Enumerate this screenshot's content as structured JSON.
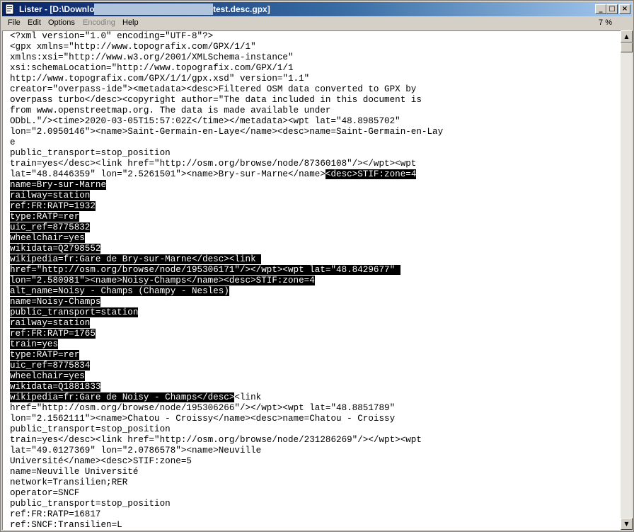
{
  "window": {
    "title_prefix": "Lister - [D:\\Downlo",
    "title_suffix": "test.desc.gpx]",
    "minimize_glyph": "_",
    "maximize_glyph": "□",
    "close_glyph": "×"
  },
  "menu": {
    "items": [
      "File",
      "Edit",
      "Options",
      "Encoding",
      "Help"
    ],
    "percent": "7 %"
  },
  "colors": {
    "titlebar_start": "#0a246a",
    "titlebar_end": "#a6caf0",
    "selection_bg": "#000000",
    "selection_fg": "#ffffff"
  },
  "icons": {
    "app": "lister-document-icon",
    "scroll_up": "scroll-up-arrow-icon",
    "scroll_down": "scroll-down-arrow-icon"
  },
  "lines": [
    [
      {
        "t": "<?xml version=\"1.0\" encoding=\"UTF-8\"?>",
        "s": false
      }
    ],
    [
      {
        "t": "<gpx xmlns=\"http://www.topografix.com/GPX/1/1\"",
        "s": false
      }
    ],
    [
      {
        "t": "xmlns:xsi=\"http://www.w3.org/2001/XMLSchema-instance\"",
        "s": false
      }
    ],
    [
      {
        "t": "xsi:schemaLocation=\"http://www.topografix.com/GPX/1/1",
        "s": false
      }
    ],
    [
      {
        "t": "http://www.topografix.com/GPX/1/1/gpx.xsd\" version=\"1.1\"",
        "s": false
      }
    ],
    [
      {
        "t": "creator=\"overpass-ide\"><metadata><desc>Filtered OSM data converted to GPX by",
        "s": false
      }
    ],
    [
      {
        "t": "overpass turbo</desc><copyright author=\"The data included in this document is",
        "s": false
      }
    ],
    [
      {
        "t": "from www.openstreetmap.org. The data is made available under",
        "s": false
      }
    ],
    [
      {
        "t": "ODbL.\"/><time>2020-03-05T15:57:02Z</time></metadata><wpt lat=\"48.8985702\"",
        "s": false
      }
    ],
    [
      {
        "t": "lon=\"2.0950146\"><name>Saint-Germain-en-Laye</name><desc>name=Saint-Germain-en-Lay",
        "s": false
      }
    ],
    [
      {
        "t": "e",
        "s": false
      }
    ],
    [
      {
        "t": "public_transport=stop_position",
        "s": false
      }
    ],
    [
      {
        "t": "train=yes</desc><link href=\"http://osm.org/browse/node/87360108\"/></wpt><wpt",
        "s": false
      }
    ],
    [
      {
        "t": "lat=\"48.8446359\" lon=\"2.5261501\"><name>Bry-sur-Marne</name>",
        "s": false
      },
      {
        "t": "<desc>STIF:zone=4",
        "s": true
      }
    ],
    [
      {
        "t": "name=Bry-sur-Marne",
        "s": true
      }
    ],
    [
      {
        "t": "railway=station",
        "s": true
      }
    ],
    [
      {
        "t": "ref:FR:RATP=1932",
        "s": true
      }
    ],
    [
      {
        "t": "type:RATP=rer",
        "s": true
      }
    ],
    [
      {
        "t": "uic_ref=8775832",
        "s": true
      }
    ],
    [
      {
        "t": "wheelchair=yes",
        "s": true
      }
    ],
    [
      {
        "t": "wikidata=Q2798552",
        "s": true
      }
    ],
    [
      {
        "t": "wikipedia=fr:Gare de Bry-sur-Marne</desc><link ",
        "s": true
      }
    ],
    [
      {
        "t": "href=\"http://osm.org/browse/node/195306171\"/></wpt><wpt lat=\"48.8429677\" ",
        "s": true
      }
    ],
    [
      {
        "t": "lon=\"2.580981\"><name>Noisy-Champs</name><desc>STIF:zone=4",
        "s": true
      }
    ],
    [
      {
        "t": "alt_name=Noisy - Champs (Champy - Nesles)",
        "s": true
      }
    ],
    [
      {
        "t": "name=Noisy-Champs",
        "s": true
      }
    ],
    [
      {
        "t": "public_transport=station",
        "s": true
      }
    ],
    [
      {
        "t": "railway=station",
        "s": true
      }
    ],
    [
      {
        "t": "ref:FR:RATP=1765",
        "s": true
      }
    ],
    [
      {
        "t": "train=yes",
        "s": true
      }
    ],
    [
      {
        "t": "type:RATP=rer",
        "s": true
      }
    ],
    [
      {
        "t": "uic_ref=8775834",
        "s": true
      }
    ],
    [
      {
        "t": "wheelchair=yes",
        "s": true
      }
    ],
    [
      {
        "t": "wikidata=Q1881833",
        "s": true
      }
    ],
    [
      {
        "t": "wikipedia=fr:Gare de Noisy - Champs</desc>",
        "s": true
      },
      {
        "t": "<link",
        "s": false
      }
    ],
    [
      {
        "t": "href=\"http://osm.org/browse/node/195306266\"/></wpt><wpt lat=\"48.8851789\"",
        "s": false
      }
    ],
    [
      {
        "t": "lon=\"2.1562111\"><name>Chatou - Croissy</name><desc>name=Chatou - Croissy",
        "s": false
      }
    ],
    [
      {
        "t": "public_transport=stop_position",
        "s": false
      }
    ],
    [
      {
        "t": "train=yes</desc><link href=\"http://osm.org/browse/node/231286269\"/></wpt><wpt",
        "s": false
      }
    ],
    [
      {
        "t": "lat=\"49.0127369\" lon=\"2.0786578\"><name>Neuville",
        "s": false
      }
    ],
    [
      {
        "t": "Université</name><desc>STIF:zone=5",
        "s": false
      }
    ],
    [
      {
        "t": "name=Neuville Université",
        "s": false
      }
    ],
    [
      {
        "t": "network=Transilien;RER",
        "s": false
      }
    ],
    [
      {
        "t": "operator=SNCF",
        "s": false
      }
    ],
    [
      {
        "t": "public_transport=stop_position",
        "s": false
      }
    ],
    [
      {
        "t": "ref:FR:RATP=16817",
        "s": false
      }
    ],
    [
      {
        "t": "ref:SNCF:Transilien=L",
        "s": false
      }
    ]
  ]
}
